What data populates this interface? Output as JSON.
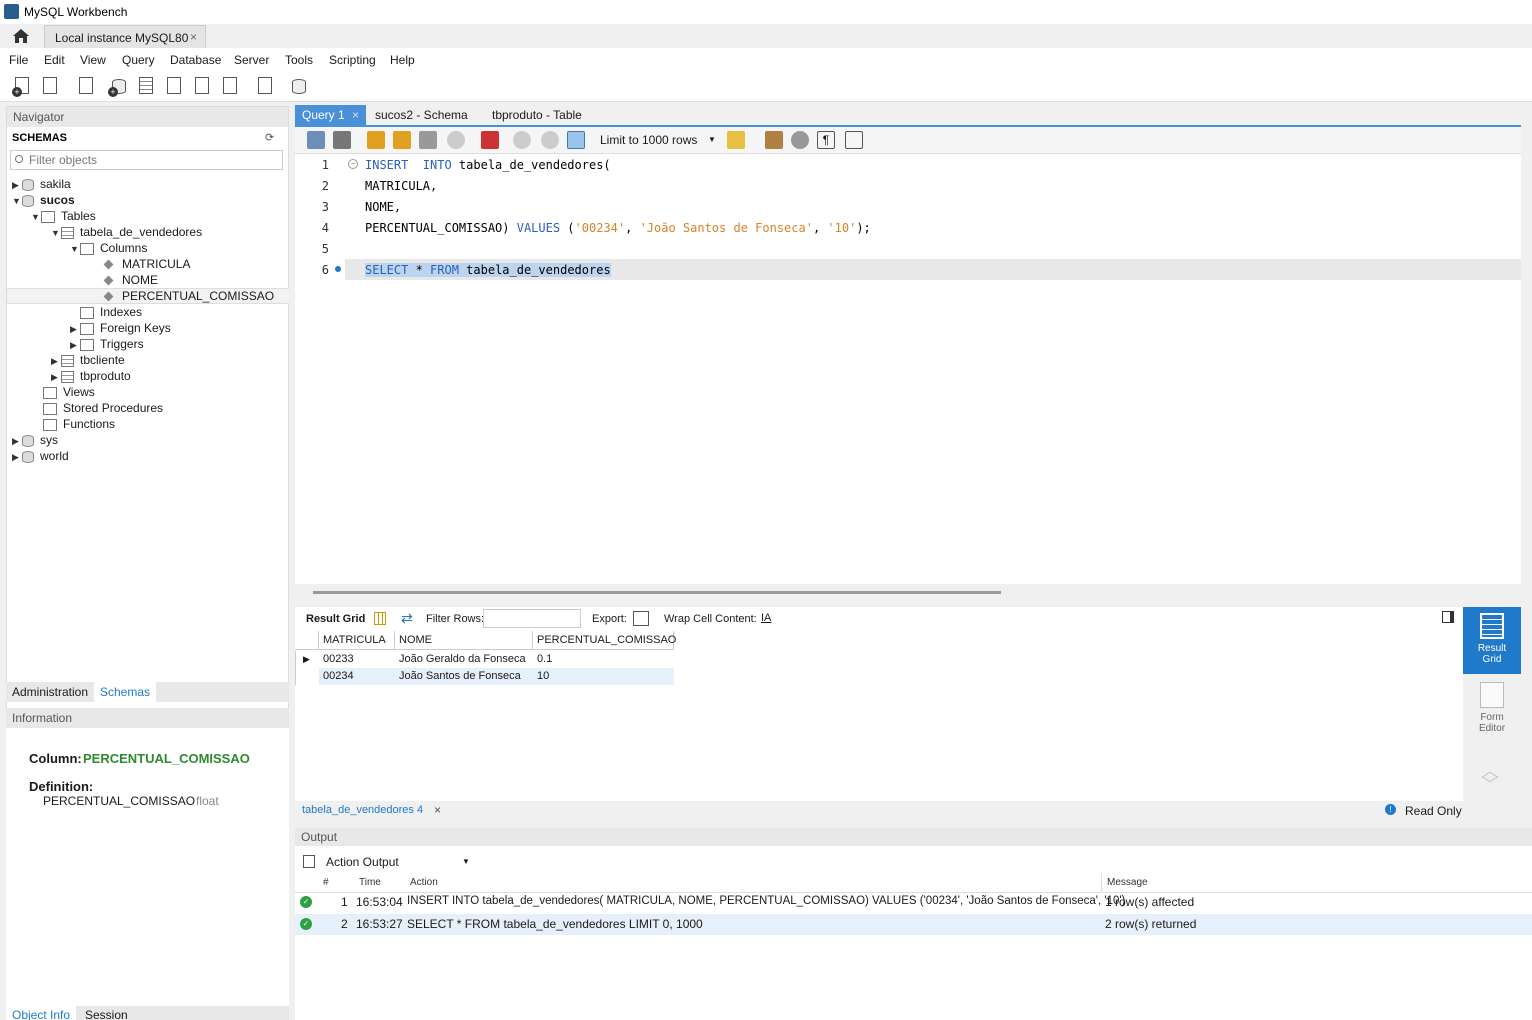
{
  "window": {
    "title": "MySQL Workbench"
  },
  "connection_tab": {
    "label": "Local instance MySQL80",
    "close": "×"
  },
  "menu": [
    "File",
    "Edit",
    "View",
    "Query",
    "Database",
    "Server",
    "Tools",
    "Scripting",
    "Help"
  ],
  "navigator": {
    "header": "Navigator",
    "schemas_label": "SCHEMAS",
    "filter_placeholder": "Filter objects",
    "tree": {
      "sakila": "sakila",
      "sucos": "sucos",
      "tables": "Tables",
      "tabela": "tabela_de_vendedores",
      "columns": "Columns",
      "col1": "MATRICULA",
      "col2": "NOME",
      "col3": "PERCENTUAL_COMISSAO",
      "indexes": "Indexes",
      "foreign_keys": "Foreign Keys",
      "triggers": "Triggers",
      "tbcliente": "tbcliente",
      "tbproduto": "tbproduto",
      "views": "Views",
      "stored_procedures": "Stored Procedures",
      "functions": "Functions",
      "sys": "sys",
      "world": "world"
    },
    "tabs": {
      "administration": "Administration",
      "schemas": "Schemas"
    },
    "info_header": "Information",
    "info": {
      "column_label": "Column:",
      "column_name": "PERCENTUAL_COMISSAO",
      "definition_label": "Definition:",
      "def_name": "PERCENTUAL_COMISSAO",
      "def_type": "float"
    },
    "bottom_tabs": {
      "object_info": "Object Info",
      "session": "Session"
    }
  },
  "query_tabs": [
    {
      "label": "Query 1",
      "close": "×"
    },
    {
      "label": "sucos2 - Schema"
    },
    {
      "label": "tbproduto - Table"
    }
  ],
  "editor": {
    "limit_label": "Limit to 1000 rows",
    "line_numbers": [
      "1",
      "2",
      "3",
      "4",
      "5",
      "6"
    ],
    "l1_kw": "INSERT  INTO",
    "l1_rest": " tabela_de_vendedores(",
    "l2": "MATRICULA,",
    "l3": "NOME,",
    "l4_a": "PERCENTUAL_COMISSAO) ",
    "l4_kw": "VALUES",
    "l4_b": " (",
    "l4_s1": "'00234'",
    "l4_c1": ", ",
    "l4_s2": "'João Santos de Fonseca'",
    "l4_c2": ", ",
    "l4_s3": "'10'",
    "l4_end": ");",
    "l6_kw1": "SELECT",
    "l6_star": " * ",
    "l6_kw2": "FROM",
    "l6_rest": " tabela_de_vendedores"
  },
  "result_bar": {
    "result_grid": "Result Grid",
    "filter_rows": "Filter Rows:",
    "export": "Export:",
    "wrap": "Wrap Cell Content:"
  },
  "grid": {
    "headers": [
      "MATRICULA",
      "NOME",
      "PERCENTUAL_COMISSAO"
    ],
    "rows": [
      [
        "00233",
        "João Geraldo da Fonseca",
        "0.1"
      ],
      [
        "00234",
        "João Santos de Fonseca",
        "10"
      ]
    ]
  },
  "side_buttons": {
    "result_grid_1": "Result",
    "result_grid_2": "Grid",
    "form_1": "Form",
    "form_2": "Editor"
  },
  "result_tab": {
    "label": "tabela_de_vendedores 4",
    "close": "×",
    "read_only": "Read Only"
  },
  "output": {
    "header": "Output",
    "selector": "Action Output",
    "columns": [
      "#",
      "Time",
      "Action",
      "Message"
    ],
    "rows": [
      {
        "n": "1",
        "time": "16:53:04",
        "action": "INSERT INTO tabela_de_vendedores( MATRICULA, NOME, PERCENTUAL_COMISSAO) VALUES ('00234', 'João Santos de Fonseca', '10')",
        "message": "1 row(s) affected"
      },
      {
        "n": "2",
        "time": "16:53:27",
        "action": "SELECT * FROM tabela_de_vendedores LIMIT 0, 1000",
        "message": "2 row(s) returned"
      }
    ]
  },
  "colors": {
    "accent": "#1f7acb",
    "keyword": "#2a5fbf",
    "string": "#d9822b",
    "column_green": "#2e8b2e",
    "ok_green": "#2ea043"
  }
}
